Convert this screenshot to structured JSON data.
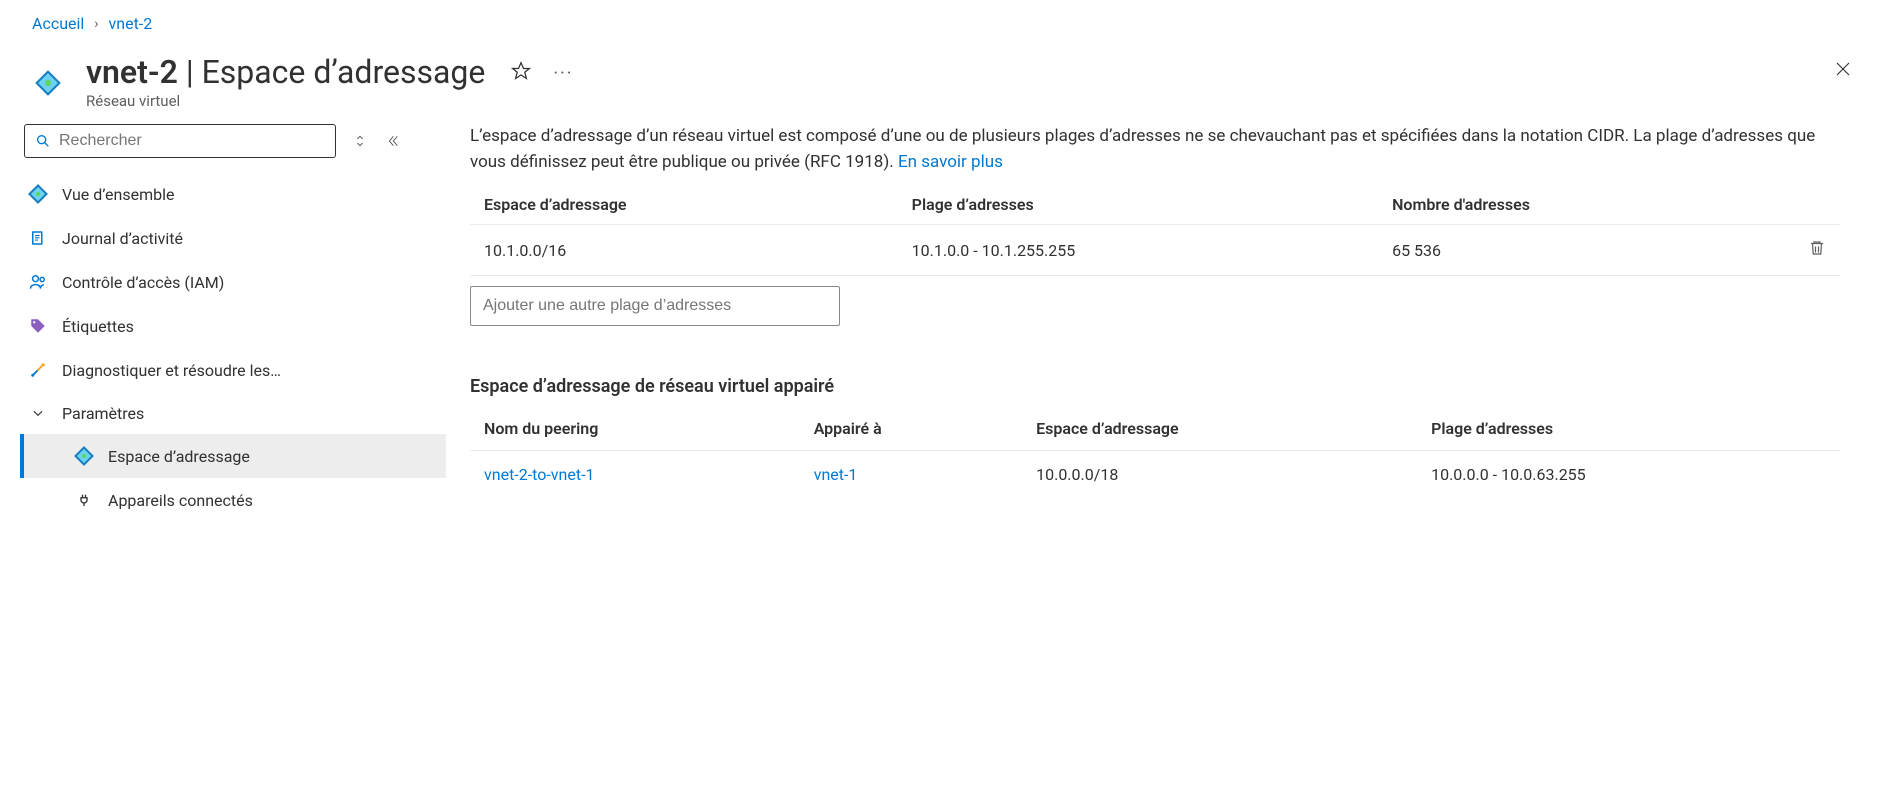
{
  "breadcrumb": {
    "home": "Accueil",
    "current": "vnet-2"
  },
  "header": {
    "resource_name": "vnet-2",
    "page_section": "Espace d’adressage",
    "subtitle": "Réseau virtuel"
  },
  "sidebar": {
    "search_placeholder": "Rechercher",
    "items": {
      "overview": "Vue d’ensemble",
      "activity_log": "Journal d’activité",
      "iam": "Contrôle d’accès (IAM)",
      "tags": "Étiquettes",
      "diagnose": "Diagnostiquer et résoudre les…",
      "settings_group": "Paramètres",
      "address_space": "Espace d’adressage",
      "connected_devices": "Appareils connectés"
    }
  },
  "main": {
    "description_prefix": "L’espace d’adressage d’un réseau virtuel est composé d’une ou de plusieurs plages d’adresses ne se chevauchant pas et spécifiées dans la notation CIDR. La plage d’adresses que vous définissez peut être publique ou privée (RFC 1918). ",
    "learn_more": "En savoir plus",
    "table1": {
      "headers": {
        "c1": "Espace d’adressage",
        "c2": "Plage d’adresses",
        "c3": "Nombre d'adresses"
      },
      "rows": [
        {
          "addr": "10.1.0.0/16",
          "range": "10.1.0.0 - 10.1.255.255",
          "count": "65 536"
        }
      ],
      "add_placeholder": "Ajouter une autre plage d’adresses"
    },
    "peered_title": "Espace d’adressage de réseau virtuel appairé",
    "table2": {
      "headers": {
        "c1": "Nom du peering",
        "c2": "Appairé à",
        "c3": "Espace d’adressage",
        "c4": "Plage d’adresses"
      },
      "rows": [
        {
          "name": "vnet-2-to-vnet-1",
          "to": "vnet-1",
          "addr": "10.0.0.0/18",
          "range": "10.0.0.0 - 10.0.63.255"
        }
      ]
    }
  }
}
